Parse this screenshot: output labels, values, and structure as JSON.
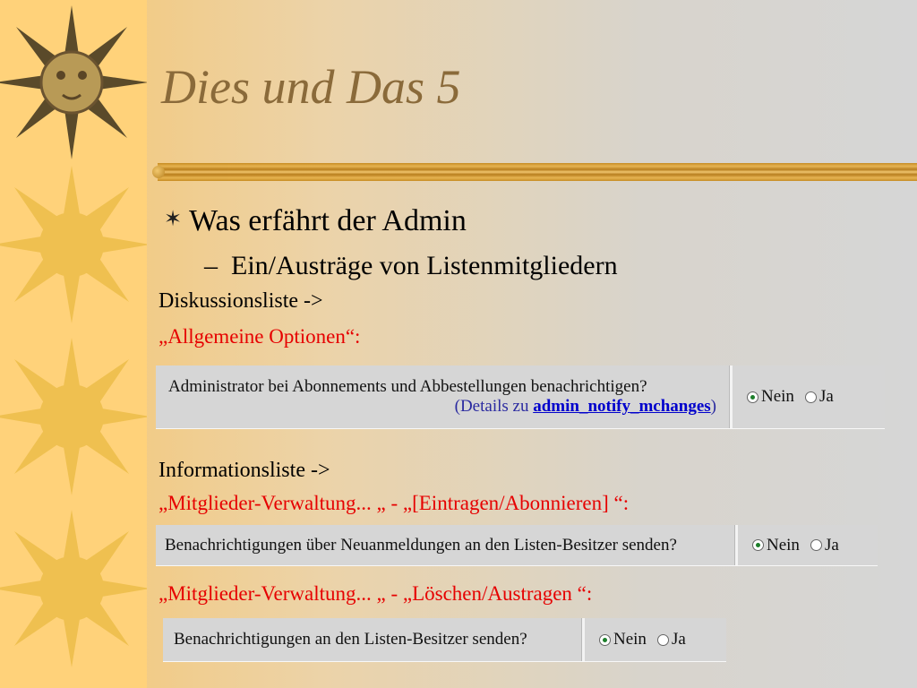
{
  "slide": {
    "title": "Dies und Das 5",
    "bullet": "Was erfährt der Admin",
    "sub_bullet": "Ein/Austräge von Listenmitgliedern"
  },
  "section1": {
    "heading": "Diskussionsliste ->",
    "path": "„Allgemeine Optionen“:",
    "option": {
      "question": "Administrator bei Abonnements und Abbestellungen benachrichtigen?",
      "details_prefix": "(Details zu ",
      "details_link": "admin_notify_mchanges",
      "details_suffix": ")",
      "radio_no": "Nein",
      "radio_yes": "Ja",
      "selected": "Nein"
    }
  },
  "section2": {
    "heading": "Informationsliste ->",
    "path": "„Mitglieder-Verwaltung... „ - „[Eintragen/Abonnieren] “:",
    "option": {
      "question": "Benachrichtigungen über Neuanmeldungen an den Listen-Besitzer senden?",
      "radio_no": "Nein",
      "radio_yes": "Ja",
      "selected": "Nein"
    }
  },
  "section3": {
    "path": "„Mitglieder-Verwaltung... „ - „Löschen/Austragen “:",
    "option": {
      "question": "Benachrichtigungen an den Listen-Besitzer senden?",
      "radio_no": "Nein",
      "radio_yes": "Ja",
      "selected": "Nein"
    }
  },
  "colors": {
    "sidebar": "#ffd27a",
    "title": "#8a6a3a",
    "accent_red": "#e60000",
    "radio_dot": "#1d7f2b"
  },
  "icons": [
    "sun-icon",
    "bullet-star-icon",
    "radio-checked-icon",
    "radio-empty-icon"
  ]
}
